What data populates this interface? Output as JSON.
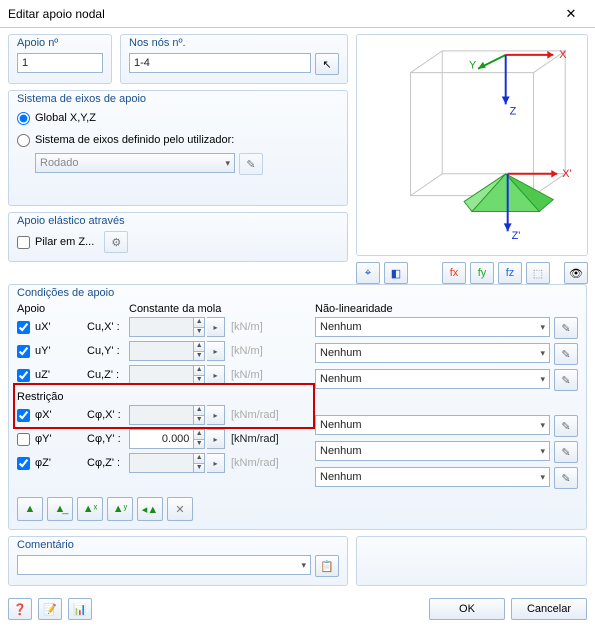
{
  "title": "Editar apoio nodal",
  "apoio_no": {
    "label": "Apoio nº",
    "value": "1"
  },
  "nos_no": {
    "label": "Nos nós nº.",
    "value": "1-4"
  },
  "sistema": {
    "title": "Sistema de eixos de apoio",
    "opt_global": "Global X,Y,Z",
    "opt_user": "Sistema de eixos definido pelo utilizador:",
    "rodado": "Rodado"
  },
  "elastico": {
    "title": "Apoio elástico através",
    "pilar": "Pilar em Z..."
  },
  "cond": {
    "title": "Condições de apoio",
    "h_apoio": "Apoio",
    "h_mola": "Constante da mola",
    "h_nl": "Não-linearidade",
    "h_restr": "Restrição",
    "rows": [
      {
        "lab": "uX'",
        "c": "Cu,X' :",
        "val": "",
        "unit": "[kN/m]",
        "chk": true,
        "dis": true,
        "nl": "Nenhum"
      },
      {
        "lab": "uY'",
        "c": "Cu,Y' :",
        "val": "",
        "unit": "[kN/m]",
        "chk": true,
        "dis": true,
        "nl": "Nenhum"
      },
      {
        "lab": "uZ'",
        "c": "Cu,Z' :",
        "val": "",
        "unit": "[kN/m]",
        "chk": true,
        "dis": true,
        "nl": "Nenhum"
      },
      {
        "lab": "φX'",
        "c": "Cφ,X' :",
        "val": "",
        "unit": "[kNm/rad]",
        "chk": true,
        "dis": true,
        "nl": "Nenhum"
      },
      {
        "lab": "φY'",
        "c": "Cφ,Y' :",
        "val": "0.000",
        "unit": "[kNm/rad]",
        "chk": false,
        "dis": false,
        "nl": "Nenhum"
      },
      {
        "lab": "φZ'",
        "c": "Cφ,Z' :",
        "val": "",
        "unit": "[kNm/rad]",
        "chk": true,
        "dis": true,
        "nl": "Nenhum"
      }
    ]
  },
  "comentario": {
    "title": "Comentário",
    "value": ""
  },
  "ok": "OK",
  "cancel": "Cancelar",
  "axes": {
    "x": "X",
    "y": "Y",
    "z": "Z",
    "xp": "X'",
    "zp": "Z'"
  }
}
